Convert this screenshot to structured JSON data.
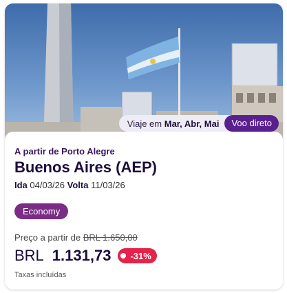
{
  "hero": {
    "months_prefix": "Viaje em",
    "months": "Mar, Abr, Mai",
    "direct_label": "Voo direto"
  },
  "offer": {
    "origin_label": "A partir de Porto Alegre",
    "destination": "Buenos Aires (AEP)",
    "outbound_label": "Ida",
    "outbound_date": "04/03/26",
    "return_label": "Volta",
    "return_date": "11/03/26",
    "cabin": "Economy",
    "from_label": "Preço a partir de",
    "old_price": "BRL  1.650,00",
    "currency": "BRL",
    "price": "1.131,73",
    "discount": "-31%",
    "taxes_note": "Taxas incluídas"
  },
  "colors": {
    "brand_purple": "#5a1f8e",
    "badge_purple": "#7a2c86",
    "discount_red": "#e5234a",
    "text_dark": "#1d0d3d"
  }
}
